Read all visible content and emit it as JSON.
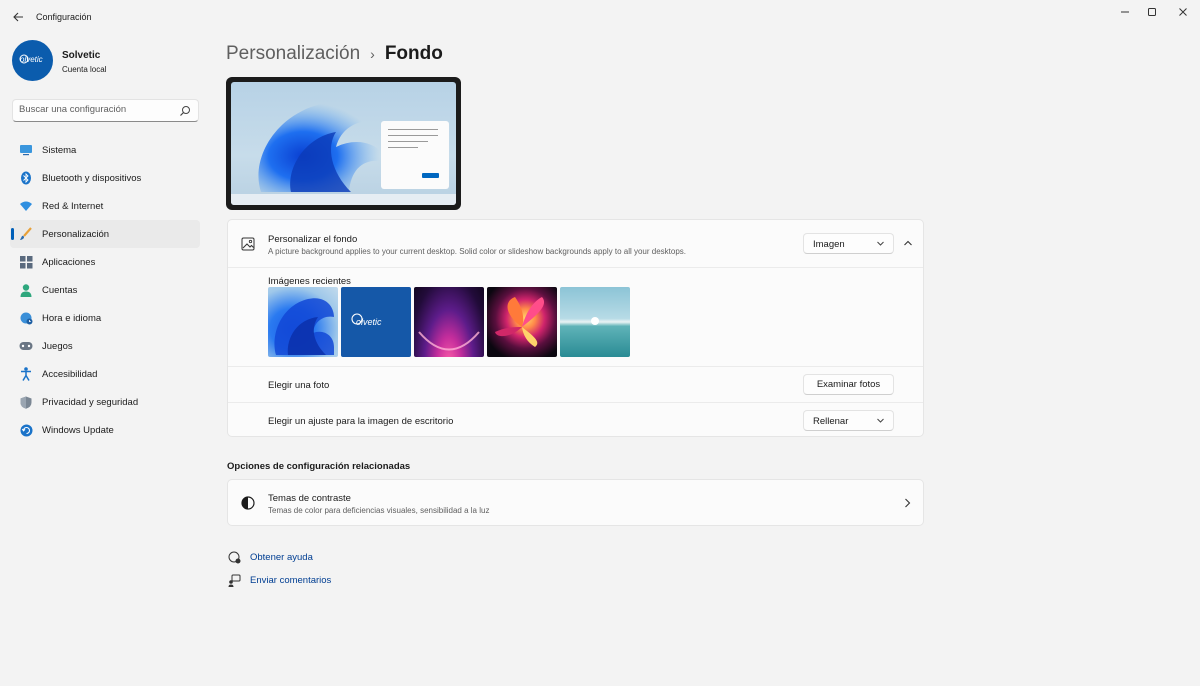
{
  "window": {
    "title": "Configuración",
    "controls": [
      "minimize-icon",
      "maximize-icon",
      "close-icon"
    ]
  },
  "profile": {
    "name": "Solvetic",
    "account_type": "Cuenta local",
    "avatar_text": "olvetic"
  },
  "search": {
    "placeholder": "Buscar una configuración"
  },
  "sidebar": {
    "active_index": 3,
    "items": [
      {
        "label": "Sistema",
        "icon": "monitor-icon"
      },
      {
        "label": "Bluetooth y dispositivos",
        "icon": "bluetooth-icon"
      },
      {
        "label": "Red & Internet",
        "icon": "wifi-icon"
      },
      {
        "label": "Personalización",
        "icon": "brush-icon"
      },
      {
        "label": "Aplicaciones",
        "icon": "apps-icon"
      },
      {
        "label": "Cuentas",
        "icon": "person-icon"
      },
      {
        "label": "Hora e idioma",
        "icon": "globe-clock-icon"
      },
      {
        "label": "Juegos",
        "icon": "gamepad-icon"
      },
      {
        "label": "Accesibilidad",
        "icon": "accessibility-icon"
      },
      {
        "label": "Privacidad y seguridad",
        "icon": "shield-icon"
      },
      {
        "label": "Windows Update",
        "icon": "update-icon"
      }
    ]
  },
  "breadcrumb": {
    "parent": "Personalización",
    "separator": "›",
    "current": "Fondo"
  },
  "background_card": {
    "title": "Personalizar el fondo",
    "subtitle": "A picture background applies to your current desktop. Solid color or slideshow backgrounds apply to all your desktops.",
    "type_value": "Imagen",
    "recent_label": "Imágenes recientes",
    "recent_images": [
      {
        "name": "windows-bloom-blue",
        "caption": ""
      },
      {
        "name": "solvetic-logo",
        "caption": "olvetic"
      },
      {
        "name": "purple-glow",
        "caption": ""
      },
      {
        "name": "flower-bloom",
        "caption": ""
      },
      {
        "name": "sea-sunrise",
        "caption": ""
      }
    ],
    "choose_photo_label": "Elegir una foto",
    "browse_button": "Examinar fotos",
    "fit_label": "Elegir un ajuste para la imagen de escritorio",
    "fit_value": "Rellenar"
  },
  "related": {
    "title": "Opciones de configuración relacionadas",
    "items": [
      {
        "title": "Temas de contraste",
        "subtitle": "Temas de color para deficiencias visuales, sensibilidad a la luz",
        "icon": "contrast-icon"
      }
    ]
  },
  "links": {
    "help": "Obtener ayuda",
    "feedback": "Enviar comentarios"
  },
  "colors": {
    "accent": "#005fb8",
    "link": "#003e92",
    "background": "#f3f3f3",
    "card": "#fbfbfb"
  }
}
